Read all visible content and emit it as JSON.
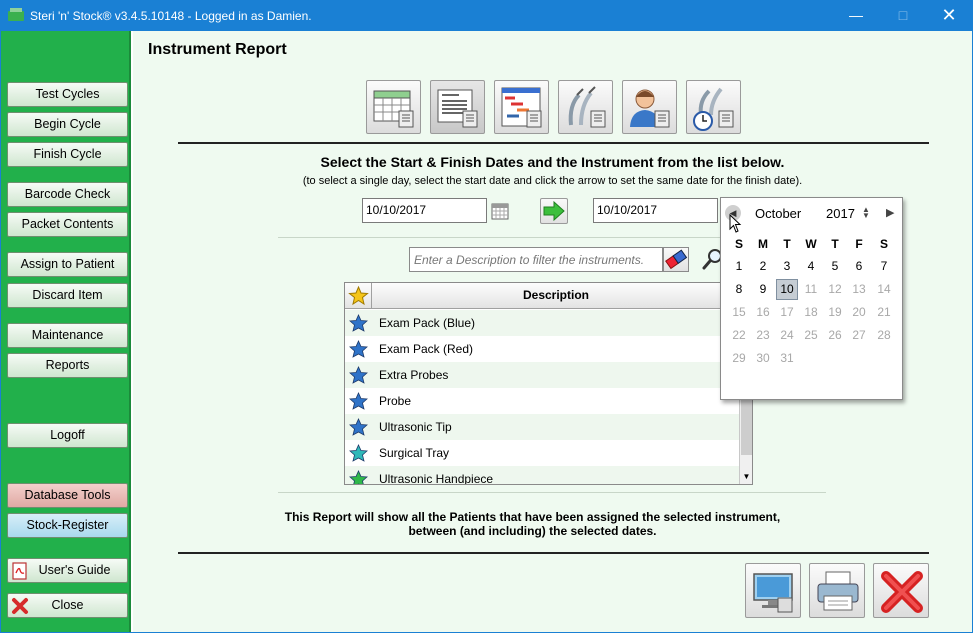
{
  "window": {
    "title": "Steri 'n' Stock® v3.4.5.10148 - Logged in as Damien.",
    "controls": [
      "minimize",
      "maximize",
      "close"
    ]
  },
  "sidebar": {
    "items": [
      {
        "label": "Test Cycles"
      },
      {
        "label": "Begin Cycle"
      },
      {
        "label": "Finish Cycle"
      },
      {
        "label": "Barcode Check"
      },
      {
        "label": "Packet Contents"
      },
      {
        "label": "Assign to Patient"
      },
      {
        "label": "Discard Item"
      },
      {
        "label": "Maintenance"
      },
      {
        "label": "Reports"
      },
      {
        "label": "Logoff"
      },
      {
        "label": "Database Tools"
      },
      {
        "label": "Stock-Register"
      },
      {
        "label": "User's Guide"
      },
      {
        "label": "Close"
      }
    ]
  },
  "main": {
    "title": "Instrument Report",
    "toolbar_icons": [
      "calendar-report-icon",
      "list-report-icon",
      "chart-report-icon",
      "instrument-report-icon",
      "patient-report-icon",
      "instrument-time-report-icon"
    ],
    "instruction": "Select the Start & Finish Dates and the Instrument from the list below.",
    "instruction_sub": "(to select a single day, select the start date and click the arrow to set the same date for the finish date).",
    "start_date": "10/10/2017",
    "finish_date": "10/10/2017",
    "filter_placeholder": "Enter a Description to filter the instruments.",
    "table": {
      "header": "Description",
      "rows": [
        {
          "label": "Exam Pack (Blue)",
          "star": "#2f73c8"
        },
        {
          "label": "Exam Pack (Red)",
          "star": "#2f73c8"
        },
        {
          "label": "Extra Probes",
          "star": "#2f73c8"
        },
        {
          "label": "Probe",
          "star": "#2f73c8"
        },
        {
          "label": "Ultrasonic Tip",
          "star": "#2f73c8"
        },
        {
          "label": "Surgical Tray",
          "star": "#2fb8b8"
        },
        {
          "label": "Ultrasonic Handpiece",
          "star": "#2fb84a"
        }
      ]
    },
    "note_line1": "This Report will show all the Patients that have been assigned the selected instrument,",
    "note_line2": "between (and including) the selected dates."
  },
  "calendar": {
    "month": "October",
    "year": "2017",
    "weekdays": [
      "S",
      "M",
      "T",
      "W",
      "T",
      "F",
      "S"
    ],
    "selected_day": "10",
    "weeks": [
      [
        "1",
        "2",
        "3",
        "4",
        "5",
        "6",
        "7"
      ],
      [
        "8",
        "9",
        "10",
        "11",
        "12",
        "13",
        "14"
      ],
      [
        "15",
        "16",
        "17",
        "18",
        "19",
        "20",
        "21"
      ],
      [
        "22",
        "23",
        "24",
        "25",
        "26",
        "27",
        "28"
      ],
      [
        "29",
        "30",
        "31"
      ]
    ]
  }
}
